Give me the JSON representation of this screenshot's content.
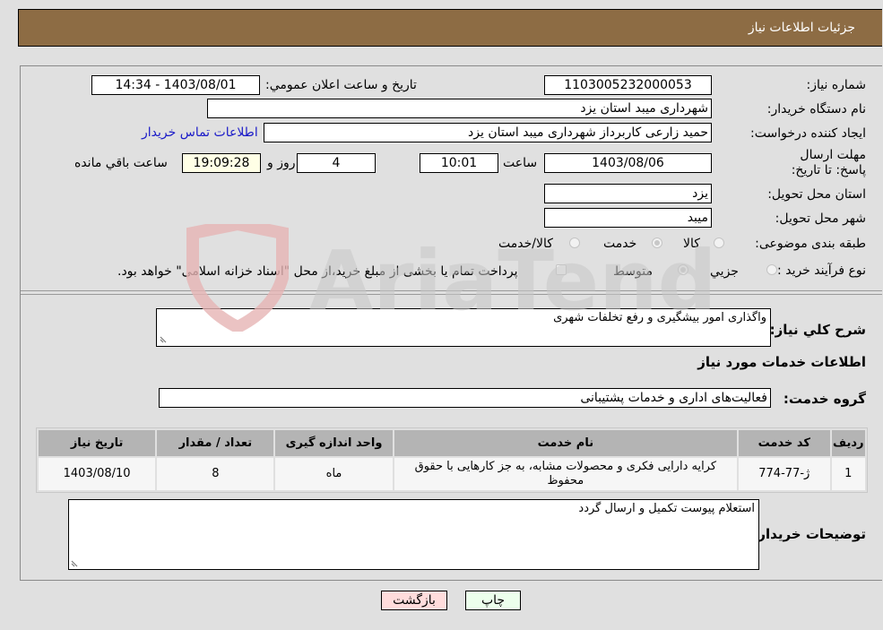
{
  "header": {
    "title": "جزئیات اطلاعات نیاز"
  },
  "form": {
    "need_number": {
      "label": "شماره نیاز:",
      "value": "1103005232000053"
    },
    "announce_datetime": {
      "label": "تاریخ و ساعت اعلان عمومي:",
      "value": "1403/08/01 - 14:34"
    },
    "buyer_org": {
      "label": "نام دستگاه خريدار:",
      "value": "شهرداری میبد استان یزد"
    },
    "requester": {
      "label": "ايجاد کننده درخواست:",
      "value": "حمید زارعی کاربرداز شهرداری میبد استان یزد"
    },
    "buyer_contact_link": "اطلاعات تماس خريدار",
    "deadline": {
      "label": "مهلت ارسال پاسخ: تا تاریخ:",
      "date": "1403/08/06",
      "time_label": "ساعت",
      "time": "10:01",
      "days": "4",
      "days_label": "روز و",
      "remaining": "19:09:28",
      "remaining_label": "ساعت باقي مانده"
    },
    "delivery_province": {
      "label": "استان محل تحویل:",
      "value": "یزد"
    },
    "delivery_city": {
      "label": "شهر محل تحویل:",
      "value": "میبد"
    },
    "category": {
      "label": "طبقه بندی موضوعی:",
      "options": [
        "کالا",
        "خدمت",
        "کالا/خدمت"
      ],
      "selected": "خدمت"
    },
    "purchase_process": {
      "label": "نوع فرآيند خريد :",
      "options": [
        "جزيي",
        "متوسط"
      ],
      "selected": "متوسط",
      "treasury_note": "پرداخت تمام یا بخشی از مبلغ خرید،از محل \"اسناد خزانه اسلامی\" خواهد بود."
    },
    "general_description": {
      "label": "شرح کلي نياز:",
      "value": "واگذاری امور بیشگیری و رفع تخلفات شهری"
    },
    "services_section_title": "اطلاعات خدمات مورد نياز",
    "service_group": {
      "label": "گروه خدمت:",
      "value": "فعالیت‌های اداری و خدمات پشتیبانی"
    }
  },
  "services_table": {
    "headers": [
      "ردیف",
      "کد خدمت",
      "نام خدمت",
      "واحد اندازه گیری",
      "تعداد / مقدار",
      "تاریخ نیاز"
    ],
    "rows": [
      {
        "row": "1",
        "code": "ژ-77-774",
        "name": "کرایه دارایی فکری و محصولات مشابه، به جز کارهایی با حقوق محفوظ",
        "unit": "ماه",
        "quantity": "8",
        "need_date": "1403/08/10"
      }
    ]
  },
  "buyer_notes": {
    "label": "توضیحات خریدار:",
    "value": "استعلام پیوست تکمیل و ارسال گردد"
  },
  "buttons": {
    "print": "چاپ",
    "back": "بازگشت"
  },
  "watermark": {
    "text": "AriaTender.neT"
  },
  "colors": {
    "header_bg": "#8d6c44",
    "print_button_bg": "#ecffec",
    "back_button_bg": "#ffdcdc",
    "link": "#1a1ac8",
    "remaining_bg": "#ffffe6"
  }
}
